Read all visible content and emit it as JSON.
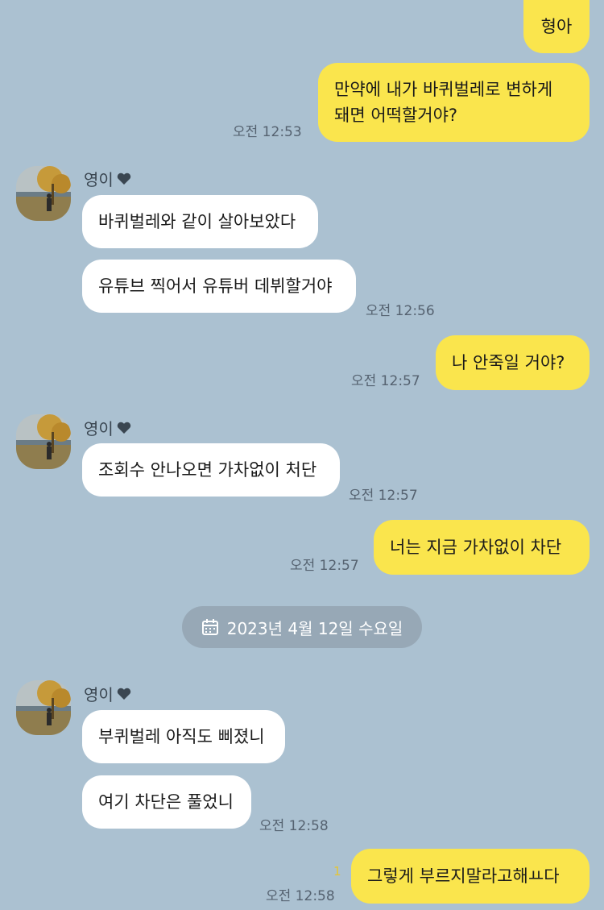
{
  "contact_name": "영이",
  "icons": {
    "heart": "heart-icon",
    "calendar": "calendar-icon"
  },
  "messages": [
    {
      "side": "me",
      "text": "형아"
    },
    {
      "side": "me",
      "lines": [
        "만약에 내가 바퀴벌레로 변하게",
        "돼면 어떡할거야?"
      ],
      "time": "오전 12:53"
    },
    {
      "side": "other",
      "text": "바퀴벌레와 같이 살아보았다"
    },
    {
      "side": "other",
      "text": "유튜브 찍어서 유튜버 데뷔할거야",
      "time": "오전 12:56"
    },
    {
      "side": "me",
      "text": "나 안죽일 거야?",
      "time": "오전 12:57"
    },
    {
      "side": "other",
      "text": "조회수 안나오면 가차없이 처단",
      "time": "오전 12:57"
    },
    {
      "side": "me",
      "text": "너는 지금 가차없이 차단",
      "time": "오전 12:57"
    },
    {
      "side": "other",
      "text": "부퀴벌레 아직도 삐졌니"
    },
    {
      "side": "other",
      "text": "여기 차단은 풀었니",
      "time": "오전 12:58"
    },
    {
      "side": "me",
      "text": "그렇게 부르지말라고해ㅛ다",
      "time": "오전 12:58",
      "unread": "1"
    }
  ],
  "date_divider": "2023년 4월 12일 수요일"
}
